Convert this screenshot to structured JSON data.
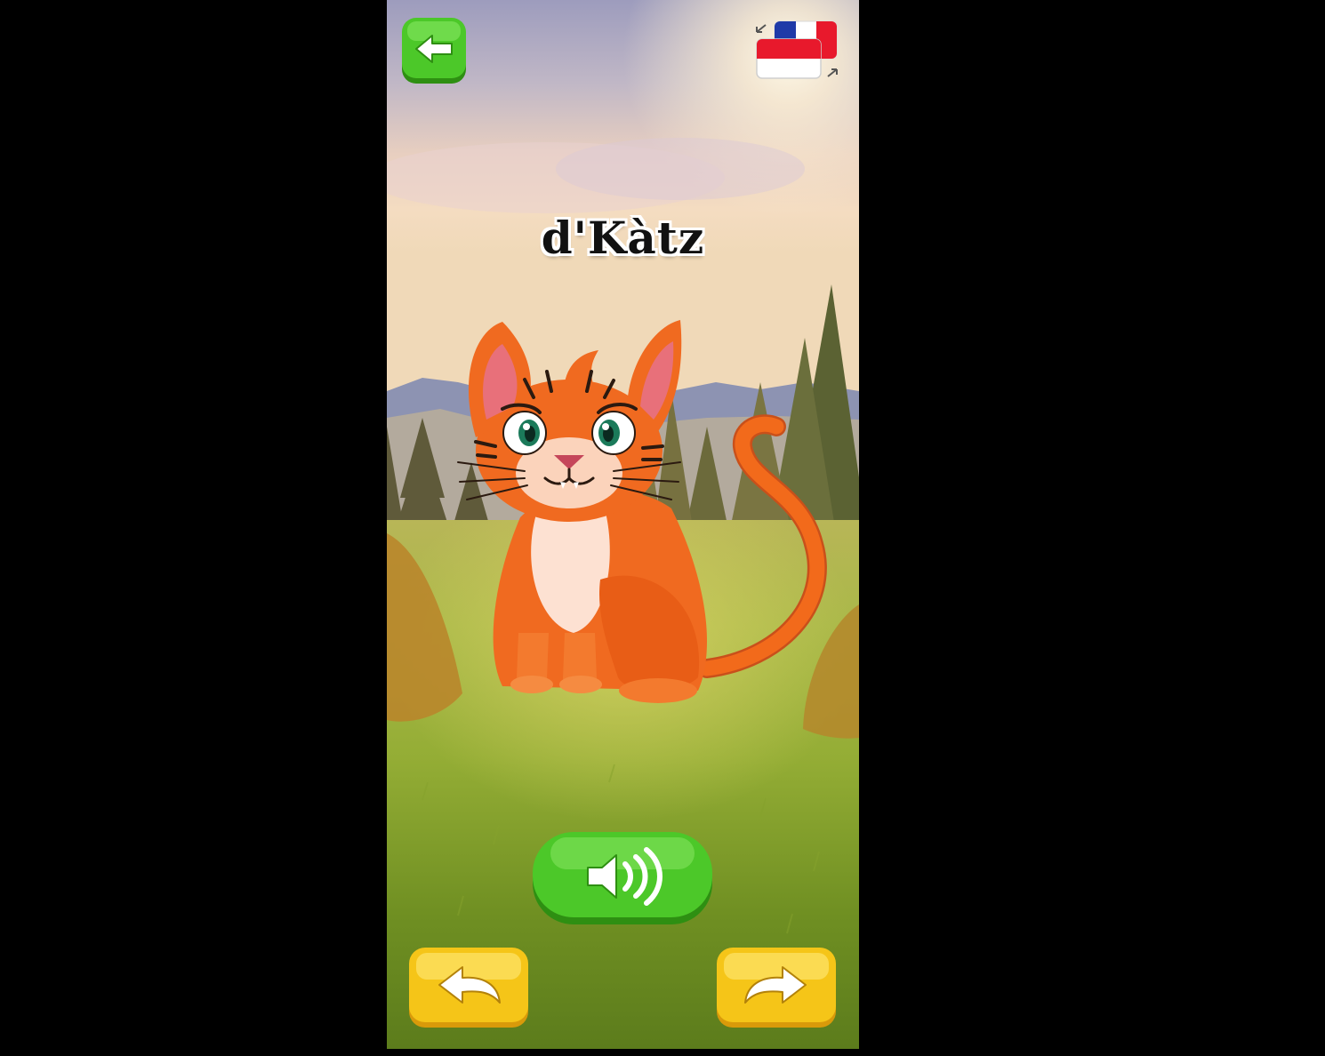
{
  "screen": {
    "animal_word": "d'Kàtz",
    "animal_image": "cat-icon"
  },
  "controls": {
    "back_icon": "arrow-left-icon",
    "language_icon": "language-swap-icon",
    "language_flags": [
      "france-flag",
      "indonesia-flag"
    ],
    "sound_icon": "speaker-icon",
    "previous_icon": "curved-arrow-left-icon",
    "next_icon": "curved-arrow-right-icon"
  },
  "colors": {
    "green_button": "#4cc829",
    "yellow_button": "#f5c518",
    "cat_orange": "#f26a1b",
    "sky_top": "#a9a8c6",
    "grass": "#7fa62a"
  }
}
